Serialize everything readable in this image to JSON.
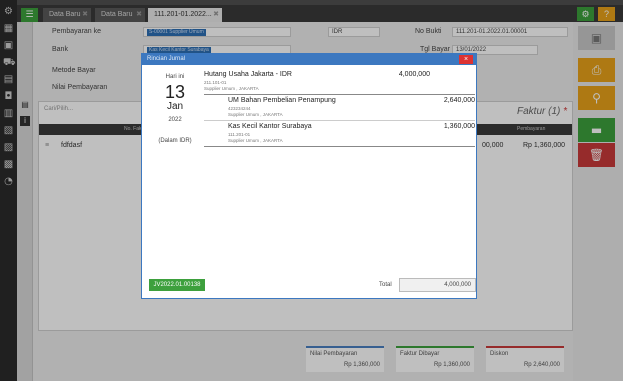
{
  "tabs": [
    {
      "label": "Data Baru"
    },
    {
      "label": "Data Baru"
    },
    {
      "label": "111.201-01.2022..."
    }
  ],
  "form": {
    "pembayaran_label": "Pembayaran ke",
    "pembayaran_value": "S-00001 Supplier Umum",
    "bank_label": "Bank",
    "bank_value": "Kas Kecil Kantor Surabaya",
    "metode_label": "Metode Bayar",
    "nilai_label": "Nilai Pembayaran",
    "currency_value": "IDR",
    "no_bukti_label": "No Bukti",
    "no_bukti_value": "111.201-01.2022.01.00001",
    "tgl_bayar_label": "Tgl Bayar",
    "tgl_bayar_value": "13/01/2022"
  },
  "grid": {
    "search_placeholder": "Cari/Pilih...",
    "faktur_title": "Faktur (1)",
    "faktur_required": "*",
    "col_no_faktur": "No. Faktur",
    "col_pembayaran": "Pembayaran",
    "row_faktur": "fdfdasf",
    "row_amount_1": "00,000",
    "row_amount_2": "Rp 1,360,000"
  },
  "summary": [
    {
      "title": "Nilai Pembayaran",
      "value": "Rp 1,360,000",
      "color": "#4a7fc1"
    },
    {
      "title": "Faktur Dibayar",
      "value": "Rp 1,360,000",
      "color": "#3da03d"
    },
    {
      "title": "Diskon",
      "value": "Rp 2,640,000",
      "color": "#c83a3a"
    }
  ],
  "modal": {
    "title": "Rincian Jurnal",
    "close": "×",
    "hari_ini": "Hari ini",
    "day": "13",
    "month": "Jan",
    "year": "2022",
    "currency_note": "(Dalam IDR)",
    "entries": [
      {
        "name": "Hutang Usaha Jakarta - IDR",
        "code": "211.101-01",
        "party": "Supplier Umum , JAKARTA",
        "amount": "4,000,000"
      },
      {
        "name": "UM Bahan Pembelian Penampung",
        "code": "423234244",
        "party": "Supplier Umum , JAKARTA",
        "amount": "2,640,000"
      },
      {
        "name": "Kas Kecil Kantor Surabaya",
        "code": "111.201-01",
        "party": "Supplier Umum , JAKARTA",
        "amount": "1,360,000"
      }
    ],
    "jv_number": "JV2022.01.00138",
    "total_label": "Total",
    "total_value": "4,000,000"
  },
  "colors": {
    "accent_blue": "#3c78c0",
    "green": "#3da03d",
    "orange": "#e8a21a",
    "red": "#c83a3a",
    "dark": "#2b2b2b"
  },
  "icons": {
    "rail": [
      "gear-icon",
      "building-icon",
      "window-icon",
      "cart-icon",
      "book-icon",
      "wallet-icon",
      "money-icon",
      "store-icon",
      "ledger-icon",
      "report-icon",
      "chart-icon"
    ]
  }
}
